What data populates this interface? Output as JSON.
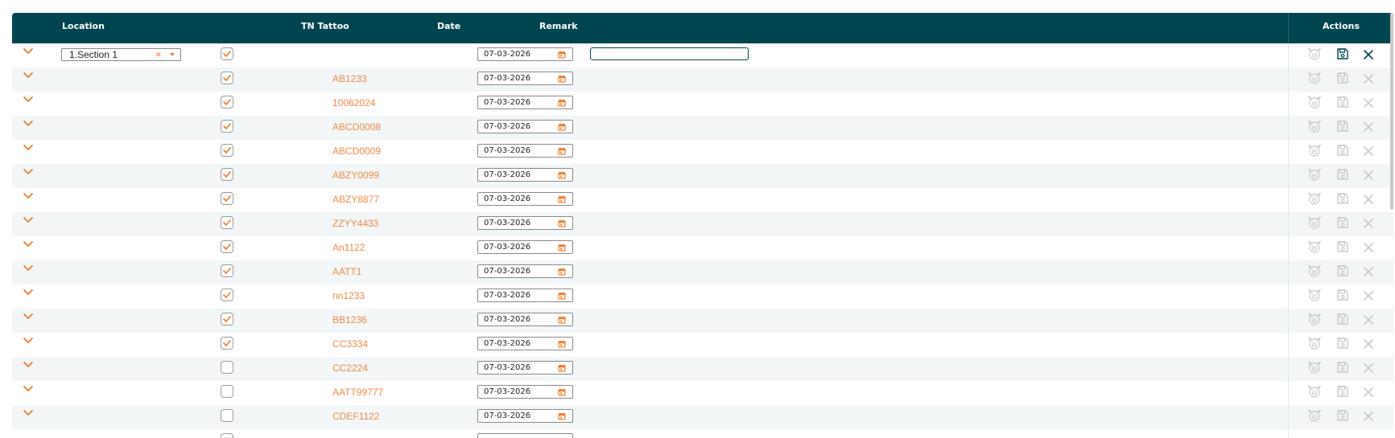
{
  "table": {
    "headers": {
      "location": "Location",
      "tn_tattoo": "TN Tattoo",
      "date": "Date",
      "remark": "Remark",
      "actions": "Actions"
    },
    "edit_row": {
      "location_value": "1.Section 1",
      "checked": true,
      "date": "07-03-2026",
      "remark_value": ""
    },
    "rows": [
      {
        "tattoo": "AB1233",
        "checked": true,
        "date": "07-03-2026"
      },
      {
        "tattoo": "10062024",
        "checked": true,
        "date": "07-03-2026"
      },
      {
        "tattoo": "ABCD0008",
        "checked": true,
        "date": "07-03-2026"
      },
      {
        "tattoo": "ABCD0009",
        "checked": true,
        "date": "07-03-2026"
      },
      {
        "tattoo": "ABZY0099",
        "checked": true,
        "date": "07-03-2026"
      },
      {
        "tattoo": "ABZY8877",
        "checked": true,
        "date": "07-03-2026"
      },
      {
        "tattoo": "ZZYY4433",
        "checked": true,
        "date": "07-03-2026"
      },
      {
        "tattoo": "An1122",
        "checked": true,
        "date": "07-03-2026"
      },
      {
        "tattoo": "AATT1",
        "checked": true,
        "date": "07-03-2026"
      },
      {
        "tattoo": "nn1233",
        "checked": true,
        "date": "07-03-2026"
      },
      {
        "tattoo": "BB1236",
        "checked": true,
        "date": "07-03-2026"
      },
      {
        "tattoo": "CC3334",
        "checked": true,
        "date": "07-03-2026"
      },
      {
        "tattoo": "CC2224",
        "checked": false,
        "date": "07-03-2026"
      },
      {
        "tattoo": "AATT99777",
        "checked": false,
        "date": "07-03-2026"
      },
      {
        "tattoo": "CDEF1122",
        "checked": false,
        "date": "07-03-2026"
      }
    ]
  },
  "colors": {
    "header_bg": "#00454f",
    "accent_orange": "#ef7a2a",
    "tattoo_text": "#ef8a4a",
    "row_alt_bg": "#f2f6f6",
    "action_disabled": "#c8c8c8"
  },
  "icons": {
    "expand": "chevron-down-icon",
    "calendar": "calendar-icon",
    "check": "check-icon",
    "animal": "pig-face-icon",
    "save": "save-icon",
    "close": "close-icon",
    "clear": "clear-x-icon",
    "dropdown": "caret-down-icon"
  }
}
